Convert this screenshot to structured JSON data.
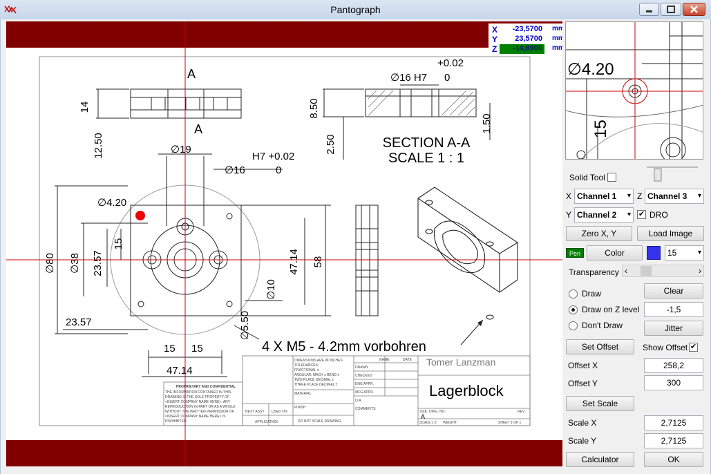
{
  "window": {
    "title": "Pantograph"
  },
  "dro": {
    "x_label": "X",
    "x_value": "-23,5700",
    "y_label": "Y",
    "y_value": "23,5700",
    "z_label": "Z",
    "z_value": "-14,8900",
    "unit": "mm"
  },
  "drawing": {
    "dim_a": "A",
    "dim_14": "14",
    "dim_12_50": "12.50",
    "dim_8_50": "8.50",
    "dim_2_50": "2.50",
    "dim_1_50": "1.50",
    "tol_plus": "+0.02",
    "dia16h7": "∅16 H7",
    "zero": "0",
    "section_title": "SECTION A-A",
    "section_scale": "SCALE 1 : 1",
    "dia19": "∅19",
    "h7_tol": "H7 +0.02",
    "dia16": "∅16",
    "dia420": "∅4.20",
    "dia80": "∅80",
    "dia38": "∅38",
    "dim_23_57": "23.57",
    "dim_15": "15",
    "dim_47_14": "47.14",
    "dim_58": "58",
    "dia10": "∅10",
    "dia550": "∅5.50",
    "note_m5": "4 X M5 - 4.2mm vorbohren",
    "author": "Tomer Lanzman",
    "part_name": "Lagerblock",
    "tb_dims": "DIMENSIONS ARE IN INCHES",
    "tb_tol": "TOLERANCES:",
    "tb_frac": "FRACTIONAL ±",
    "tb_ang": "ANGULAR: MACH ±   BEND ±",
    "tb_two": "TWO PLACE DECIMAL   ±",
    "tb_three": "THREE PLACE DECIMAL  ±",
    "tb_name": "NAME",
    "tb_date": "DATE",
    "tb_drawn": "DRAWN",
    "tb_checked": "CHECKED",
    "tb_eng": "ENG APPR.",
    "tb_mfg": "MFG APPR.",
    "tb_qa": "Q.A.",
    "tb_comments": "COMMENTS:",
    "tb_material": "MATERIAL",
    "tb_finish": "FINISH",
    "tb_next": "NEXT ASSY",
    "tb_used": "USED ON",
    "tb_app": "APPLICATION",
    "tb_noscale": "DO NOT SCALE DRAWING",
    "tb_size": "SIZE",
    "tb_size_val": "A",
    "tb_dwg": "DWG.  NO.",
    "tb_rev": "REV",
    "tb_scale": "SCALE:1:2",
    "tb_weight": "WEIGHT:",
    "tb_sheet": "SHEET 1 OF 1",
    "tb_prop_title": "PROPRIETARY AND CONFIDENTIAL",
    "tb_prop_1": "THE INFORMATION CONTAINED IN THIS",
    "tb_prop_2": "DRAWING IS THE SOLE PROPERTY OF",
    "tb_prop_3": "<INSERT COMPANY NAME HERE>.  ANY",
    "tb_prop_4": "REPRODUCTION IN PART OR AS A WHOLE",
    "tb_prop_5": "WITHOUT THE WRITTEN PERMISSION OF",
    "tb_prop_6": "<INSERT COMPANY NAME HERE> IS",
    "tb_prop_7": "PROHIBITED."
  },
  "preview": {
    "dim_label": "∅4.20",
    "dim_15": "15"
  },
  "controls": {
    "solid_tool": "Solid Tool",
    "x_label": "X",
    "x_channel": "Channel 1",
    "z_label": "Z",
    "z_channel": "Channel 3",
    "y_label": "Y",
    "y_channel": "Channel 2",
    "dro_label": "DRO",
    "zero_xy": "Zero X, Y",
    "load_image": "Load Image",
    "pen_badge": "Pen",
    "color_btn": "Color",
    "pen_size": "15",
    "transparency": "Transparency",
    "draw": "Draw",
    "draw_z": "Draw on Z level",
    "dont_draw": "Don't Draw",
    "clear": "Clear",
    "z_level": "-1,5",
    "jitter": "Jitter",
    "set_offset": "Set Offset",
    "show_offset": "Show Offset",
    "offset_x_label": "Offset X",
    "offset_x": "258,2",
    "offset_y_label": "Offset Y",
    "offset_y": "300",
    "set_scale": "Set Scale",
    "scale_x_label": "Scale X",
    "scale_x": "2,7125",
    "scale_y_label": "Scale Y",
    "scale_y": "2,7125",
    "calculator": "Calculator",
    "ok": "OK",
    "check_mark": "✔",
    "dropdown_arrow": "▾",
    "scroll_left": "‹",
    "scroll_right": "›"
  },
  "colors": {
    "band": "#800000",
    "crosshair": "#cc0000",
    "pen": "#3333ee",
    "pen_badge": "#008000",
    "dro_text": "#0000cc"
  },
  "icons": {
    "app": "pantograph-icon",
    "minimize": "minimize-icon",
    "maximize": "maximize-icon",
    "close": "close-icon"
  }
}
